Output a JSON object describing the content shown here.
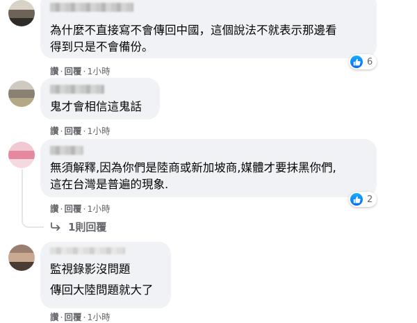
{
  "comments": [
    {
      "lines": [
        "為什麼不直接寫不會傳回中國，這個說法不就表示那邊看",
        "得到只是不會備份。"
      ],
      "actions": {
        "like": "讚",
        "reply": "回覆",
        "time": "1小時"
      },
      "reaction_count": "6"
    },
    {
      "lines": [
        "鬼才會相信這鬼話"
      ],
      "actions": {
        "like": "讚",
        "reply": "回覆",
        "time": "1小時"
      }
    },
    {
      "lines": [
        "無須解釋,因為你們是陸商或新加坡商,媒體才要抹黑你們,",
        "這在台灣是普遍的現象."
      ],
      "actions": {
        "like": "讚",
        "reply": "回覆",
        "time": "1小時"
      },
      "reaction_count": "2",
      "replies_link": "1則回覆"
    },
    {
      "lines": [
        "監視錄影沒問題",
        "傳回大陸問題就大了"
      ],
      "actions": {
        "like": "讚",
        "reply": "回覆",
        "time": "1小時"
      }
    }
  ],
  "colors": {
    "bubble": "#f0f2f5",
    "secondary_text": "#65676b",
    "like_blue": "#0866ff"
  },
  "icons": [
    "thumbs-up-icon",
    "reply-arrow-icon"
  ]
}
